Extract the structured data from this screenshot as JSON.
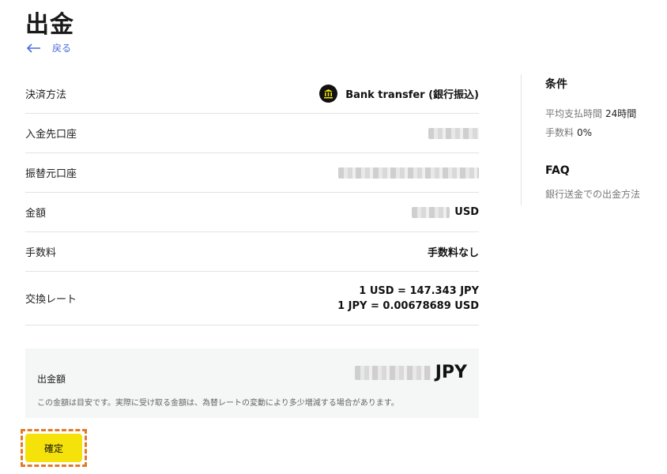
{
  "page": {
    "title": "出金",
    "back_label": "戻る"
  },
  "rows": [
    {
      "label": "決済方法",
      "value": "Bank transfer (銀行振込)"
    },
    {
      "label": "入金先口座",
      "value": ""
    },
    {
      "label": "振替元口座",
      "value": ""
    },
    {
      "label": "金額",
      "currency": "USD"
    },
    {
      "label": "手数料",
      "value": "手数料なし"
    },
    {
      "label": "交換レート",
      "rate_line1": "1 USD = 147.343 JPY",
      "rate_line2": "1 JPY = 0.00678689 USD"
    }
  ],
  "summary": {
    "label": "出金額",
    "currency": "JPY",
    "note": "この金額は目安です。実際に受け取る金額は、為替レートの変動により多少増減する場合があります。"
  },
  "confirm_label": "確定",
  "sidebar": {
    "conditions_title": "条件",
    "conditions": [
      {
        "key": "平均支払時間",
        "value": "24時間"
      },
      {
        "key": "手数料",
        "value": "0%"
      }
    ],
    "faq_title": "FAQ",
    "faq_link": "銀行送金での出金方法"
  },
  "colors": {
    "accent": "#f4e20a",
    "link": "#4b6cdb",
    "highlight_border": "#e07a2a"
  },
  "icons": {
    "back": "arrow-left-icon",
    "bank": "bank-icon"
  }
}
